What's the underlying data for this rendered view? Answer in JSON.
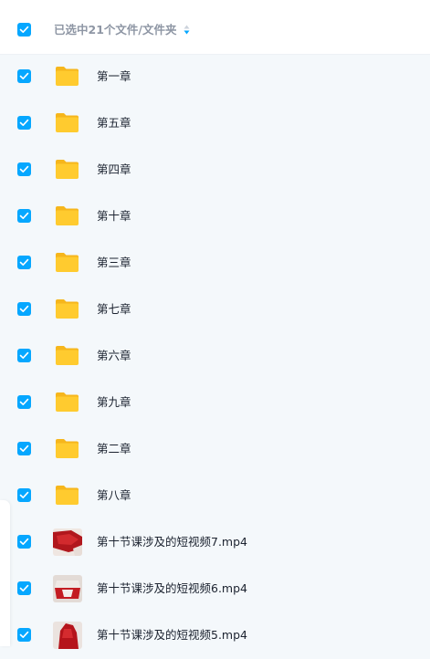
{
  "header": {
    "checked": true,
    "selection_label": "已选中21个文件/文件夹",
    "sort_icon": "sort-order-icon"
  },
  "colors": {
    "accent": "#06a7ff",
    "folder": "#ffcb2f",
    "page_background": "#f4f8fb"
  },
  "rows": [
    {
      "type": "folder",
      "name": "第一章",
      "checked": true
    },
    {
      "type": "folder",
      "name": "第五章",
      "checked": true
    },
    {
      "type": "folder",
      "name": "第四章",
      "checked": true
    },
    {
      "type": "folder",
      "name": "第十章",
      "checked": true
    },
    {
      "type": "folder",
      "name": "第三章",
      "checked": true
    },
    {
      "type": "folder",
      "name": "第七章",
      "checked": true
    },
    {
      "type": "folder",
      "name": "第六章",
      "checked": true
    },
    {
      "type": "folder",
      "name": "第九章",
      "checked": true
    },
    {
      "type": "folder",
      "name": "第二章",
      "checked": true
    },
    {
      "type": "folder",
      "name": "第八章",
      "checked": true
    },
    {
      "type": "video",
      "name": "第十节课涉及的短视频7.mp4",
      "checked": true
    },
    {
      "type": "video",
      "name": "第十节课涉及的短视频6.mp4",
      "checked": true
    },
    {
      "type": "video",
      "name": "第十节课涉及的短视频5.mp4",
      "checked": true
    }
  ]
}
